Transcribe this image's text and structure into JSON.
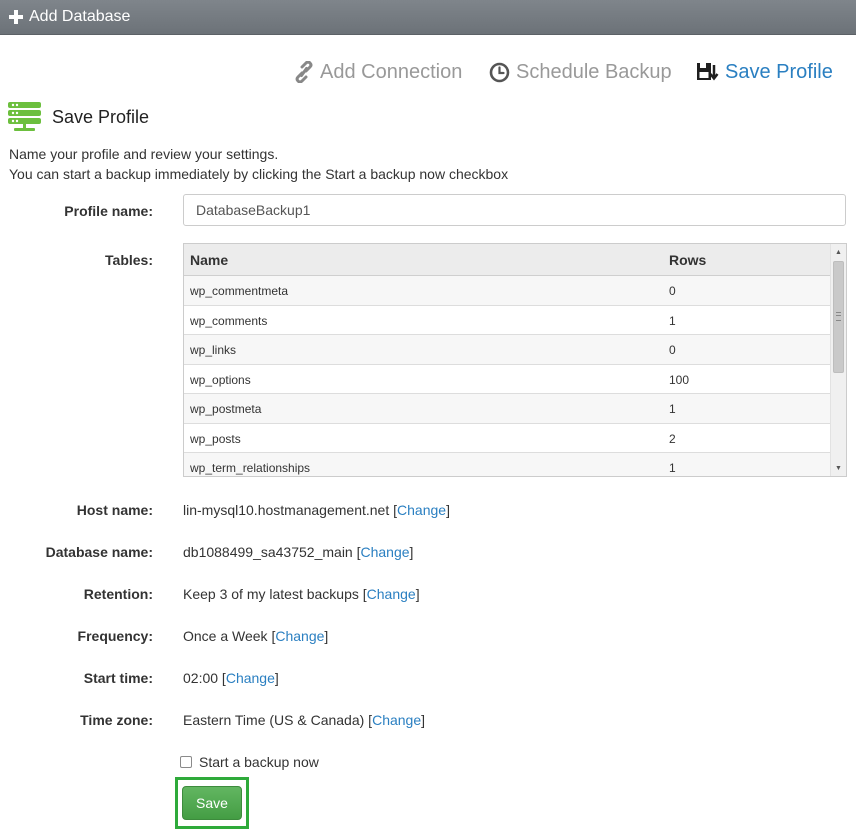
{
  "window": {
    "title": "Add Database"
  },
  "wizard": {
    "steps": [
      {
        "label": "Add Connection",
        "icon": "link-icon",
        "state": "inactive"
      },
      {
        "label": "Schedule Backup",
        "icon": "clock-icon",
        "state": "inactive"
      },
      {
        "label": "Save Profile",
        "icon": "save-profile-icon",
        "state": "active"
      }
    ]
  },
  "section": {
    "title": "Save Profile",
    "icon": "database-server-icon"
  },
  "intro": {
    "line1": "Name your profile and review your settings.",
    "line2": "You can start a backup immediately by clicking the Start a backup now checkbox"
  },
  "form": {
    "profile_name": {
      "label": "Profile name:",
      "value": "DatabaseBackup1"
    },
    "tables": {
      "label": "Tables:",
      "columns": [
        "Name",
        "Rows"
      ],
      "rows": [
        [
          "wp_commentmeta",
          "0"
        ],
        [
          "wp_comments",
          "1"
        ],
        [
          "wp_links",
          "0"
        ],
        [
          "wp_options",
          "100"
        ],
        [
          "wp_postmeta",
          "1"
        ],
        [
          "wp_posts",
          "2"
        ],
        [
          "wp_term_relationships",
          "1"
        ]
      ]
    },
    "host_name": {
      "label": "Host name:",
      "value": "lin-mysql10.hostmanagement.net"
    },
    "database_name": {
      "label": "Database name:",
      "value": "db1088499_sa43752_main"
    },
    "retention": {
      "label": "Retention:",
      "value": "Keep 3 of my latest backups"
    },
    "frequency": {
      "label": "Frequency:",
      "value": "Once a Week"
    },
    "start_time": {
      "label": "Start time:",
      "value": "02:00"
    },
    "time_zone": {
      "label": "Time zone:",
      "value": "Eastern Time (US & Canada)"
    },
    "change_link": "Change",
    "start_backup_checkbox": {
      "label": "Start a backup now",
      "checked": false
    },
    "save_label": "Save"
  },
  "colors": {
    "title_bar": "#747a80",
    "accent": "#2a7fc1",
    "inactive_step": "#999999",
    "save_button": "#4cae4c",
    "highlight": "#2eaa3a",
    "icon_green": "#6cbf3e"
  }
}
